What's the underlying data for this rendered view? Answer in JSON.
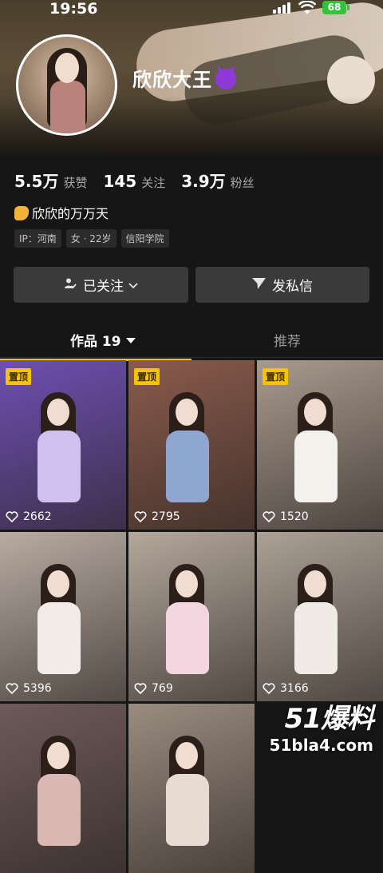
{
  "status_bar": {
    "time": "19:56",
    "battery": "68"
  },
  "profile": {
    "name": "欣欣大王",
    "stats": [
      {
        "value": "5.5万",
        "label": "获赞"
      },
      {
        "value": "145",
        "label": "关注"
      },
      {
        "value": "3.9万",
        "label": "粉丝"
      }
    ],
    "bio": "欣欣的万万天",
    "tags": [
      "IP：河南",
      "女 · 22岁",
      "信阳学院"
    ]
  },
  "actions": {
    "follow_label": "已关注",
    "message_label": "发私信"
  },
  "tabs": [
    {
      "label": "作品 19"
    },
    {
      "label": "推荐"
    }
  ],
  "videos": [
    {
      "pinned": "置顶",
      "likes": "2662",
      "bg": "#6e4fb2",
      "top": "#d0c0f0"
    },
    {
      "pinned": "置顶",
      "likes": "2795",
      "bg": "#8a5b4c",
      "top": "#8fa6d0"
    },
    {
      "pinned": "置顶",
      "likes": "1520",
      "bg": "#a89a8e",
      "top": "#f4f0ec"
    },
    {
      "pinned": "",
      "likes": "5396",
      "bg": "#b8aca2",
      "top": "#f2ece8"
    },
    {
      "pinned": "",
      "likes": "769",
      "bg": "#b4a89c",
      "top": "#f3d6df"
    },
    {
      "pinned": "",
      "likes": "3166",
      "bg": "#aca196",
      "top": "#f1ebe6"
    },
    {
      "pinned": "",
      "likes": "",
      "bg": "#6d5a5a",
      "top": "#d9b8b4"
    },
    {
      "pinned": "",
      "likes": "",
      "bg": "#9a8c80",
      "top": "#e8dbd2"
    }
  ],
  "watermark": {
    "logo": "51爆料",
    "url": "51bla4.com"
  }
}
